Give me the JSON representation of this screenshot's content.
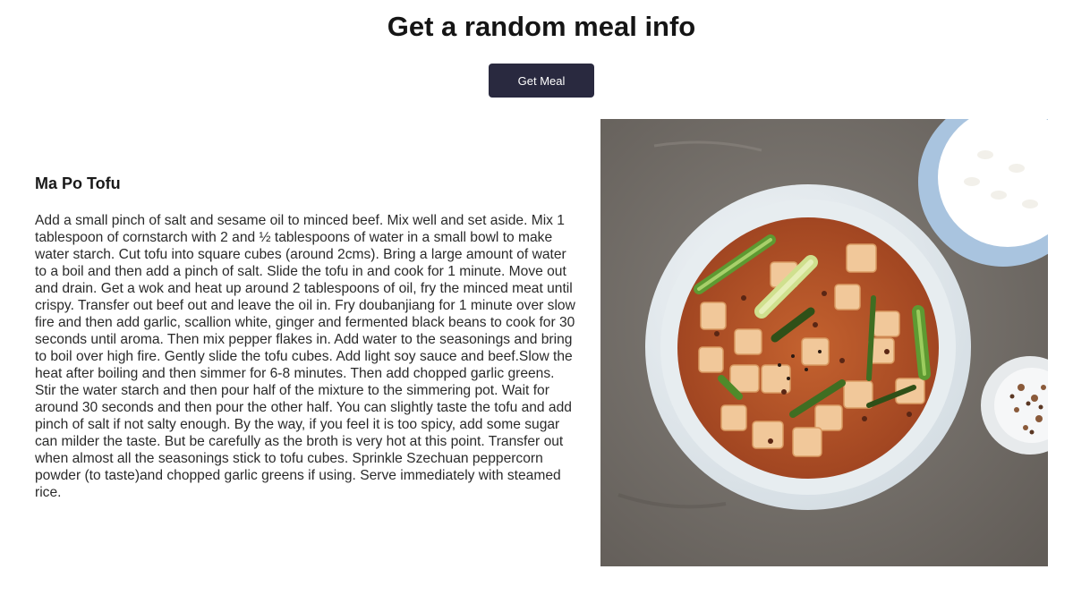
{
  "header": {
    "title": "Get a random meal info"
  },
  "controls": {
    "get_meal_label": "Get Meal"
  },
  "meal": {
    "name": "Ma Po Tofu",
    "instructions": "Add a small pinch of salt and sesame oil to minced beef. Mix well and set aside. Mix 1 tablespoon of cornstarch with 2 and ½ tablespoons of water in a small bowl to make water starch. Cut tofu into square cubes (around 2cms). Bring a large amount of water to a boil and then add a pinch of salt. Slide the tofu in and cook for 1 minute. Move out and drain. Get a wok and heat up around 2 tablespoons of oil, fry the minced meat until crispy. Transfer out beef out and leave the oil in. Fry doubanjiang for 1 minute over slow fire and then add garlic, scallion white, ginger and fermented black beans to cook for 30 seconds until aroma. Then mix pepper flakes in. Add water to the seasonings and bring to boil over high fire. Gently slide the tofu cubes. Add light soy sauce and beef.Slow the heat after boiling and then simmer for 6-8 minutes. Then add chopped garlic greens. Stir the water starch and then pour half of the mixture to the simmering pot. Wait for around 30 seconds and then pour the other half. You can slightly taste the tofu and add pinch of salt if not salty enough. By the way, if you feel it is too spicy, add some sugar can milder the taste. But be carefully as the broth is very hot at this point. Transfer out when almost all the seasonings stick to tofu cubes. Sprinkle Szechuan peppercorn powder (to taste)and chopped garlic greens if using. Serve immediately with steamed rice."
  },
  "colors": {
    "button_bg": "#29293f",
    "button_text": "#ffffff",
    "table_surface": "#7a7570",
    "bowl": "#e9eef1",
    "sauce": "#b5532a",
    "tofu": "#f1c89a",
    "scallion": "#5e9a32",
    "rice_bowl": "#a9c4df"
  }
}
